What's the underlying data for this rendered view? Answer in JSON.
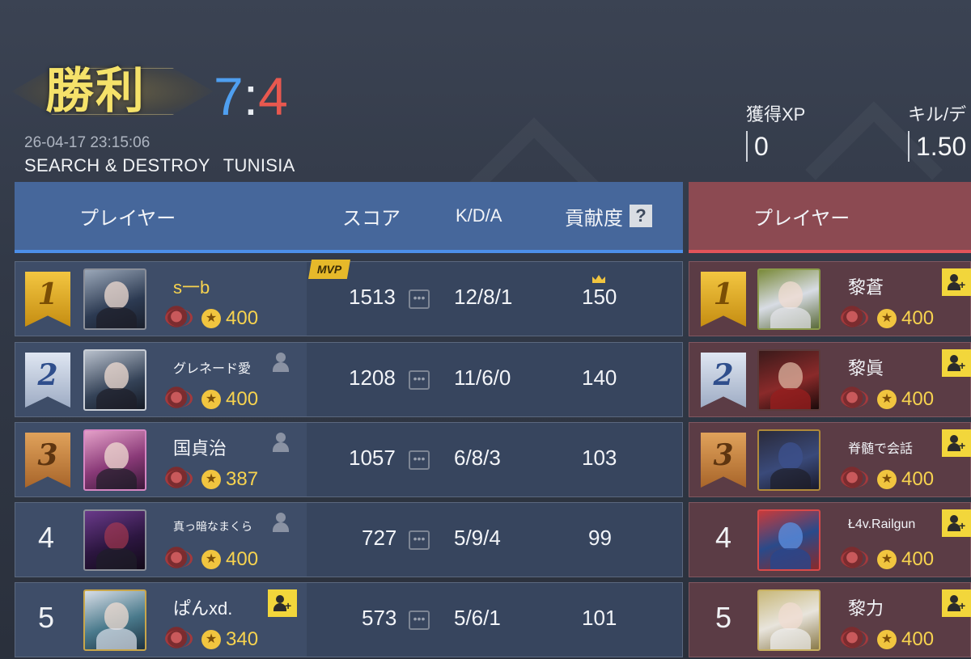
{
  "header": {
    "result": "勝利",
    "score_blue": "7",
    "score_sep": ":",
    "score_red": "4",
    "datetime": "26-04-17 23:15:06",
    "mode": "SEARCH & DESTROY",
    "map": "TUNISIA",
    "stats": [
      {
        "label": "獲得XP",
        "value": "0"
      },
      {
        "label": "キル/デ",
        "value": "1.50"
      }
    ]
  },
  "columns": {
    "player": "プレイヤー",
    "score": "スコア",
    "kda": "K/D/A",
    "contribution": "貢献度",
    "help": "?"
  },
  "colors": {
    "blue_team": "#4d8fe8",
    "red_team": "#e0545a",
    "gold": "#f7d34f"
  },
  "mvp_label": "MVP",
  "blue_team": [
    {
      "rank": "1",
      "name": "s一b",
      "level": "400",
      "score": "1513",
      "kda": "12/8/1",
      "contribution": "150",
      "mvp": true
    },
    {
      "rank": "2",
      "name": "グレネード愛",
      "level": "400",
      "score": "1208",
      "kda": "11/6/0",
      "contribution": "140"
    },
    {
      "rank": "3",
      "name": "国貞治",
      "level": "387",
      "score": "1057",
      "kda": "6/8/3",
      "contribution": "103"
    },
    {
      "rank": "4",
      "name": "真っ暗なまくら",
      "level": "400",
      "score": "727",
      "kda": "5/9/4",
      "contribution": "99"
    },
    {
      "rank": "5",
      "name": "ぱんxd.",
      "level": "340",
      "score": "573",
      "kda": "5/6/1",
      "contribution": "101"
    }
  ],
  "red_team": [
    {
      "rank": "1",
      "name": "黎蒼",
      "level": "400"
    },
    {
      "rank": "2",
      "name": "黎眞",
      "level": "400"
    },
    {
      "rank": "3",
      "name": "脊髄で会話",
      "level": "400"
    },
    {
      "rank": "4",
      "name": "Ł4v.Railgun",
      "level": "400"
    },
    {
      "rank": "5",
      "name": "黎力",
      "level": "400"
    }
  ]
}
